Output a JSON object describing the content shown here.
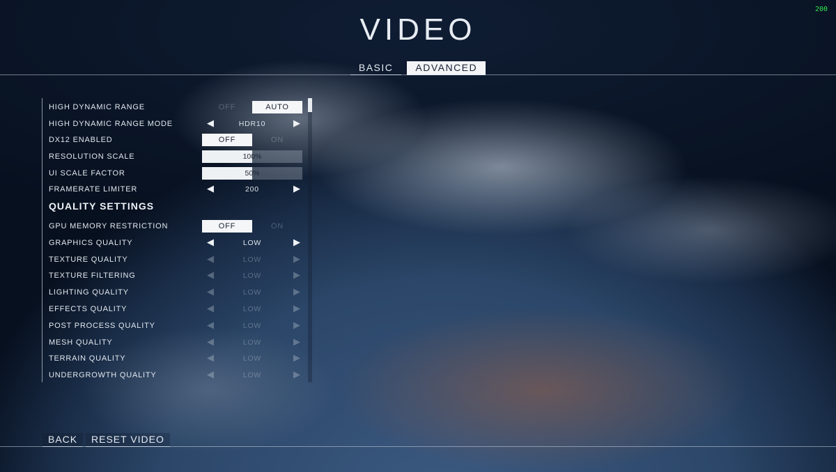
{
  "fps_counter": "200",
  "title": "VIDEO",
  "tabs": [
    {
      "label": "BASIC",
      "active": false
    },
    {
      "label": "ADVANCED",
      "active": true
    }
  ],
  "settings": {
    "hdr": {
      "label": "HIGH DYNAMIC RANGE",
      "left": "OFF",
      "right": "AUTO",
      "selected": "AUTO"
    },
    "hdr_mode": {
      "label": "HIGH DYNAMIC RANGE MODE",
      "value": "HDR10"
    },
    "dx12": {
      "label": "DX12 ENABLED",
      "left": "OFF",
      "right": "ON",
      "selected": "OFF"
    },
    "resolution_scale": {
      "label": "RESOLUTION SCALE",
      "value": "100%",
      "level": 0.5
    },
    "ui_scale": {
      "label": "UI SCALE FACTOR",
      "value": "50%",
      "level": 0.5
    },
    "framerate": {
      "label": "FRAMERATE LIMITER",
      "value": "200"
    }
  },
  "quality_section": "QUALITY SETTINGS",
  "quality": {
    "gpu_memory": {
      "label": "GPU MEMORY RESTRICTION",
      "left": "OFF",
      "right": "ON",
      "selected": "OFF"
    },
    "graphics": {
      "label": "GRAPHICS QUALITY",
      "value": "LOW"
    },
    "texture": {
      "label": "TEXTURE QUALITY",
      "value": "LOW"
    },
    "texture_filtering": {
      "label": "TEXTURE FILTERING",
      "value": "LOW"
    },
    "lighting": {
      "label": "LIGHTING QUALITY",
      "value": "LOW"
    },
    "effects": {
      "label": "EFFECTS QUALITY",
      "value": "LOW"
    },
    "post_process": {
      "label": "POST PROCESS QUALITY",
      "value": "LOW"
    },
    "mesh": {
      "label": "MESH QUALITY",
      "value": "LOW"
    },
    "terrain": {
      "label": "TERRAIN QUALITY",
      "value": "LOW"
    },
    "undergrowth": {
      "label": "UNDERGROWTH QUALITY",
      "value": "LOW"
    }
  },
  "icons": {
    "left_arrow": "arrow-left-icon",
    "right_arrow": "arrow-right-icon",
    "left_glyph": "◀",
    "right_glyph": "▶"
  },
  "footer": {
    "back": "BACK",
    "reset": "RESET VIDEO"
  }
}
